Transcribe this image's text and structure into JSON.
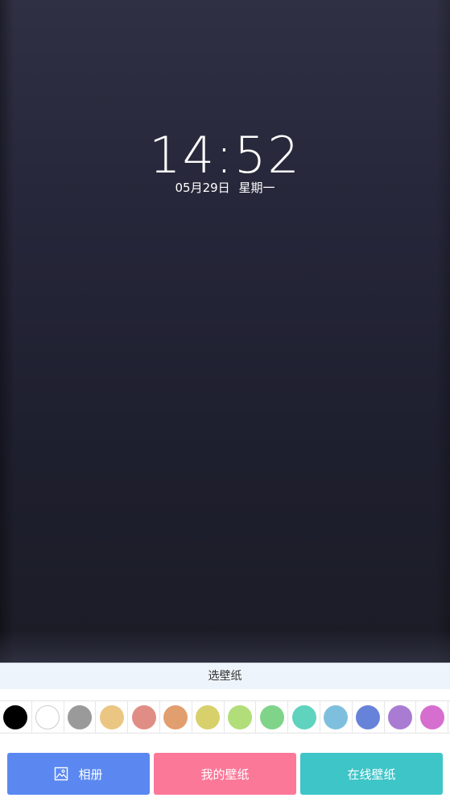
{
  "lockscreen": {
    "time": "14:52",
    "date": "05月29日",
    "weekday": "星期一"
  },
  "panel": {
    "title": "选壁纸"
  },
  "swatches": [
    {
      "color": "#000000"
    },
    {
      "color": "#ffffff"
    },
    {
      "color": "#9a9a9a"
    },
    {
      "color": "#ebc683"
    },
    {
      "color": "#e08e85"
    },
    {
      "color": "#e19e6e"
    },
    {
      "color": "#d8d06b"
    },
    {
      "color": "#b1de78"
    },
    {
      "color": "#7fd48a"
    },
    {
      "color": "#5fd3bd"
    },
    {
      "color": "#7fbfde"
    },
    {
      "color": "#6782d9"
    },
    {
      "color": "#a97bd2"
    },
    {
      "color": "#d66ecf"
    }
  ],
  "buttons": {
    "album": {
      "label": "相册",
      "color": "#5b88f0",
      "icon": "image-icon"
    },
    "my_wallpaper": {
      "label": "我的壁纸",
      "color": "#fb7899"
    },
    "online_wallpaper": {
      "label": "在线壁纸",
      "color": "#3ec5c8"
    }
  }
}
